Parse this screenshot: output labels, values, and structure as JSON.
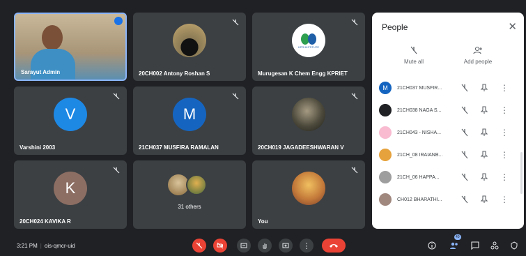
{
  "tiles": [
    {
      "name": "Sarayut Admin",
      "type": "video"
    },
    {
      "name": "20CH002 Antony Roshan S",
      "type": "photo"
    },
    {
      "name": "Murugesan K Chem Engg KPRIET",
      "type": "logo",
      "logo_caption": "KPR INSTITUTE"
    },
    {
      "name": "Varshini 2003",
      "type": "initial",
      "initial": "V",
      "color": "#1e88e5"
    },
    {
      "name": "21CH037 MUSFIRA RAMALAN",
      "type": "initial",
      "initial": "M",
      "color": "#1565c0"
    },
    {
      "name": "20CH019 JAGADEESHWARAN V",
      "type": "photo"
    },
    {
      "name": "20CH024 KAVIKA R",
      "type": "initial",
      "initial": "K",
      "color": "#8d6e63"
    },
    {
      "name": "31 others",
      "type": "others"
    },
    {
      "name": "You",
      "type": "photo"
    }
  ],
  "panel": {
    "title": "People",
    "close": "✕",
    "mute_all": "Mute all",
    "add_people": "Add people",
    "rows": [
      {
        "name": "21CH037 MUSFIR...",
        "initial": "M",
        "color": "#1565c0"
      },
      {
        "name": "21CH038 NAGA S...",
        "initial": "",
        "color": "#202124"
      },
      {
        "name": "21CH043 - NISHA...",
        "initial": "",
        "color": "#f8bbd0"
      },
      {
        "name": "21CH_08 IRAIANB...",
        "initial": "",
        "color": "#e6a23c"
      },
      {
        "name": "21CH_06 HAPPA...",
        "initial": "",
        "color": "#9e9e9e"
      },
      {
        "name": "CH012 BHARATHI...",
        "initial": "",
        "color": "#a1887f"
      }
    ]
  },
  "bottom": {
    "time": "3:21 PM",
    "separator": "|",
    "meeting_code": "ois-qmcr-uid",
    "participant_count": "40"
  }
}
